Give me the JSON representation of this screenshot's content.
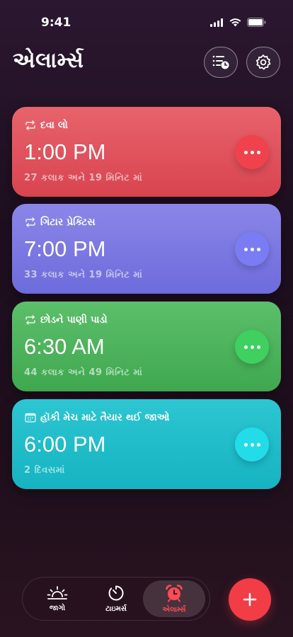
{
  "status_bar": {
    "time": "9:41"
  },
  "header": {
    "title": "એલાર્મ્સ"
  },
  "alarms": [
    {
      "label": "દવા લો",
      "time": "1:00 PM",
      "remaining": "27 કલાક અને 19 મિનિટ માં",
      "repeat_icon": "repeat-icon",
      "color": "#e0545e"
    },
    {
      "label": "ગિટાર પ્રેક્ટિસ",
      "time": "7:00 PM",
      "remaining": "33 કલાક અને 19 મિનિટ માં",
      "repeat_icon": "repeat-icon",
      "color": "#7c79e2"
    },
    {
      "label": "છોડને પાણી પાડો",
      "time": "6:30 AM",
      "remaining": "44 કલાક અને 49 મિનિટ માં",
      "repeat_icon": "repeat-icon",
      "color": "#4db45d"
    },
    {
      "label": "હૉકી મેચ માટે તૈયાર થઈ જાઓ",
      "time": "6:00 PM",
      "remaining": "2 દિવસમાં",
      "repeat_icon": "calendar-icon",
      "color": "#20bcca"
    }
  ],
  "tab_bar": {
    "tabs": [
      {
        "label": "જાગો",
        "icon": "sunrise-icon"
      },
      {
        "label": "ટાઇમર્સ",
        "icon": "timer-icon"
      },
      {
        "label": "એલાર્મ્સ",
        "icon": "alarm-clock-icon",
        "active": true
      }
    ]
  },
  "colors": {
    "accent": "#f23d46",
    "background": "#1f0f1d"
  }
}
